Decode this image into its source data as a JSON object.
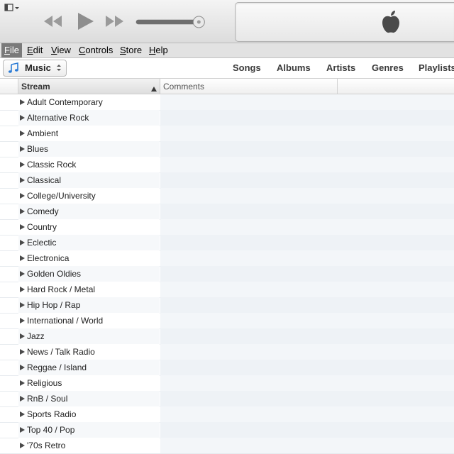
{
  "icons": {
    "sidebar_toggle": "sidebar-toggle-icon",
    "previous": "rewind-icon",
    "play": "play-icon",
    "next": "fast-forward-icon",
    "volume": "volume-slider",
    "apple": "apple-logo-icon",
    "music": "music-note-icon",
    "disclosure": "disclosure-triangle-icon",
    "sort": "sort-ascending-icon"
  },
  "player": {
    "volume_level": 0.92
  },
  "menubar": {
    "items": [
      {
        "label": "File",
        "mnemonic": "F",
        "rest": "ile",
        "active": true
      },
      {
        "label": "Edit",
        "mnemonic": "E",
        "rest": "dit",
        "active": false
      },
      {
        "label": "View",
        "mnemonic": "V",
        "rest": "iew",
        "active": false
      },
      {
        "label": "Controls",
        "mnemonic": "C",
        "rest": "ontrols",
        "active": false
      },
      {
        "label": "Store",
        "mnemonic": "S",
        "rest": "tore",
        "active": false
      },
      {
        "label": "Help",
        "mnemonic": "H",
        "rest": "elp",
        "active": false
      }
    ]
  },
  "toolbar": {
    "media_label": "Music",
    "tabs": [
      "Songs",
      "Albums",
      "Artists",
      "Genres",
      "Playlists"
    ]
  },
  "list": {
    "columns": {
      "stream": "Stream",
      "comments": "Comments"
    },
    "genres": [
      "Adult Contemporary",
      "Alternative Rock",
      "Ambient",
      "Blues",
      "Classic Rock",
      "Classical",
      "College/University",
      "Comedy",
      "Country",
      "Eclectic",
      "Electronica",
      "Golden Oldies",
      "Hard Rock / Metal",
      "Hip Hop / Rap",
      "International / World",
      "Jazz",
      "News / Talk Radio",
      "Reggae / Island",
      "Religious",
      "RnB / Soul",
      "Sports Radio",
      "Top 40 / Pop",
      "'70s Retro"
    ]
  },
  "colors": {
    "menu_active": "#7a7a7a",
    "row_alt": "#f3f6f9"
  }
}
